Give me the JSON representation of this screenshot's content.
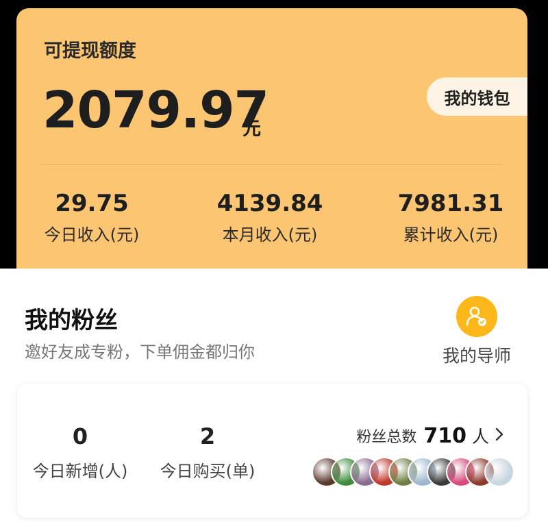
{
  "wallet": {
    "title": "可提现额度",
    "balance": "2079.97",
    "unit": "元",
    "wallet_button": "我的钱包",
    "stats": [
      {
        "value": "29.75",
        "label": "今日收入(元)"
      },
      {
        "value": "4139.84",
        "label": "本月收入(元)"
      },
      {
        "value": "7981.31",
        "label": "累计收入(元)"
      }
    ]
  },
  "fans": {
    "title": "我的粉丝",
    "subtitle": "邀好友成专粉，下单佣金都归你",
    "mentor_label": "我的导师",
    "today_new": {
      "value": "0",
      "label": "今日新增(人)"
    },
    "today_buy": {
      "value": "2",
      "label": "今日购买(单)"
    },
    "total_label": "粉丝总数",
    "total_count": "710",
    "total_unit": "人",
    "avatar_colors": [
      "#5b3a2e",
      "#3f8d3c",
      "#8a6a8f",
      "#c0392b",
      "#6f7f45",
      "#9fb8d0",
      "#3b3b3b",
      "#d94a7c",
      "#8c3a2d",
      "#c9d6e0"
    ]
  },
  "icons": {
    "wallet_arrow": "none",
    "mentor": "mentor-person-icon",
    "chevron": "chevron-right-icon"
  },
  "colors": {
    "card": "#fcc572",
    "accent": "#fcb81a"
  }
}
